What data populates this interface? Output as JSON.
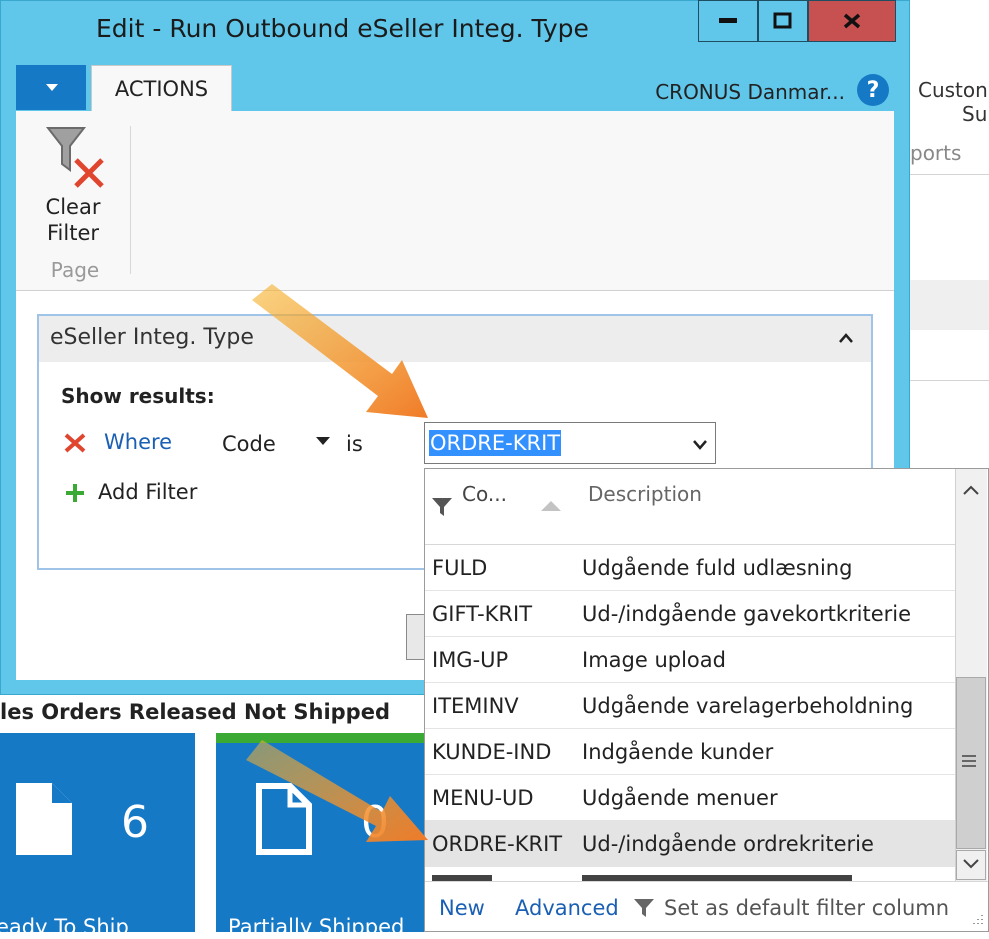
{
  "window": {
    "title": "Edit - Run Outbound eSeller Integ. Type",
    "minimize_label": "—",
    "maximize_label": "□",
    "close_label": "x"
  },
  "background": {
    "right_text_1": "Custon",
    "right_text_2": "Su",
    "right_text_3": "ports",
    "section_title": "les Orders Released Not Shipped",
    "tiles": [
      {
        "count": "6",
        "label": "eady To Ship"
      },
      {
        "count": "0",
        "label": "Partially Shipped"
      }
    ]
  },
  "ribbon": {
    "tab_actions": "ACTIONS",
    "company": "CRONUS Danmar...",
    "help_label": "?",
    "clear_filter_label_1": "Clear",
    "clear_filter_label_2": "Filter",
    "group_label": "Page"
  },
  "filter_panel": {
    "header": "eSeller Integ. Type",
    "show_results": "Show results:",
    "where_label": "Where",
    "field": "Code",
    "operator": "is",
    "value": "ORDRE-KRIT",
    "add_filter": "Add Filter"
  },
  "dropdown": {
    "col_code": "Co...",
    "col_description": "Description",
    "rows": [
      {
        "code": "FULD",
        "description": "Udgående fuld udlæsning"
      },
      {
        "code": "GIFT-KRIT",
        "description": "Ud-/indgående gavekortkriterie"
      },
      {
        "code": "IMG-UP",
        "description": "Image upload"
      },
      {
        "code": "ITEMINV",
        "description": "Udgående varelagerbeholdning"
      },
      {
        "code": "KUNDE-IND",
        "description": "Indgående kunder"
      },
      {
        "code": "MENU-UD",
        "description": "Udgående menuer"
      },
      {
        "code": "ORDRE-KRIT",
        "description": "Ud-/indgående ordrekriterie"
      }
    ],
    "footer": {
      "new": "New",
      "advanced": "Advanced",
      "set_default": "Set as default filter column"
    }
  },
  "colors": {
    "window_chrome": "#60c7ea",
    "close_button": "#c75050",
    "accent_blue": "#1679c6",
    "selection": "#3390ff"
  }
}
